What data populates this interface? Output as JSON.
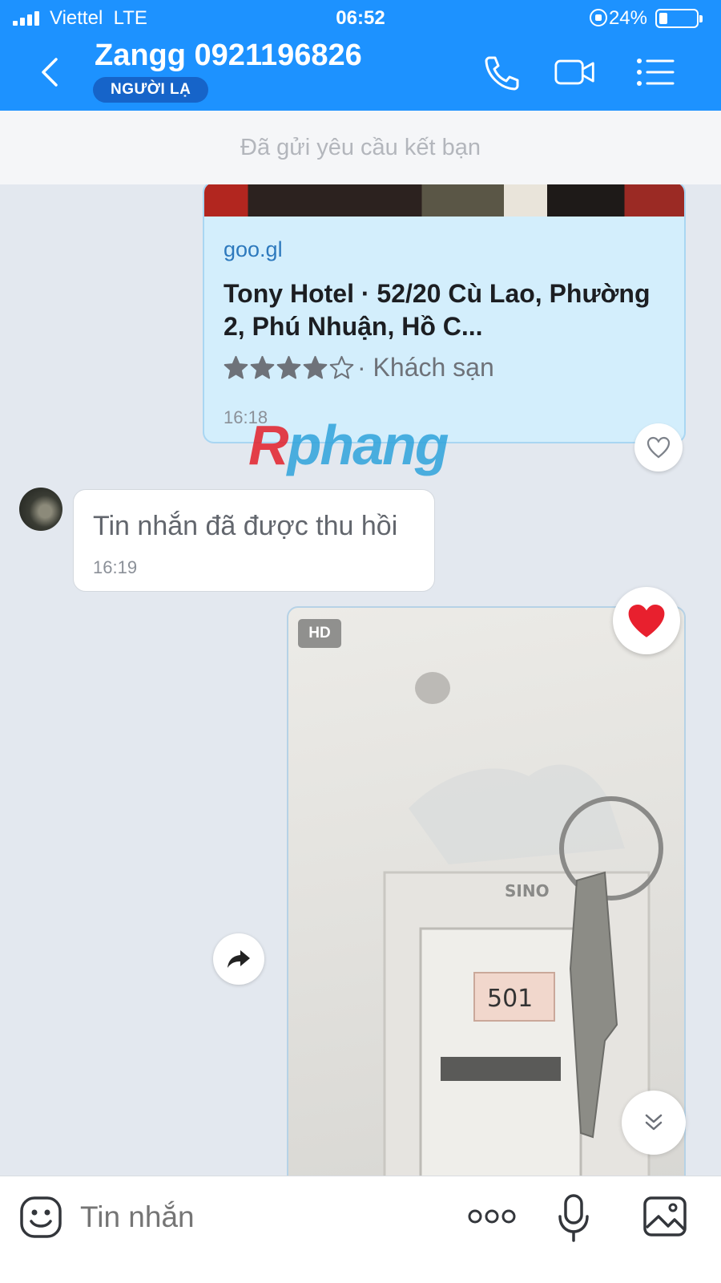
{
  "status_bar": {
    "carrier": "Viettel",
    "network": "LTE",
    "time": "06:52",
    "battery": "24%"
  },
  "header": {
    "title": "Zangg 0921196826",
    "badge": "NGƯỜI LẠ",
    "icons": [
      "back-chevron-icon",
      "phone-icon",
      "video-camera-icon",
      "menu-list-icon"
    ]
  },
  "friend_request": {
    "text": "Đã gửi yêu cầu kết bạn"
  },
  "messages": {
    "link_card": {
      "domain": "goo.gl",
      "title": "Tony Hotel · 52/20 Cù Lao, Phường 2, Phú Nhuận, Hồ C...",
      "rating": 4,
      "rating_max": 5,
      "category": "· Khách sạn",
      "time": "16:18"
    },
    "recalled": {
      "text": "Tin nhắn đã được thu hồi",
      "time": "16:19"
    },
    "photo": {
      "hd_label": "HD",
      "description_colors": {
        "accent": "#1d92ff"
      }
    }
  },
  "watermark": {
    "first": "R",
    "rest": "phang"
  },
  "input_bar": {
    "placeholder": "Tin nhắn"
  },
  "colors": {
    "header": "#1d92ff",
    "badge": "#1664c9",
    "chat_bg": "#e3e8ef",
    "link_bubble": "#d3eefc",
    "heart": "#e8202e"
  }
}
